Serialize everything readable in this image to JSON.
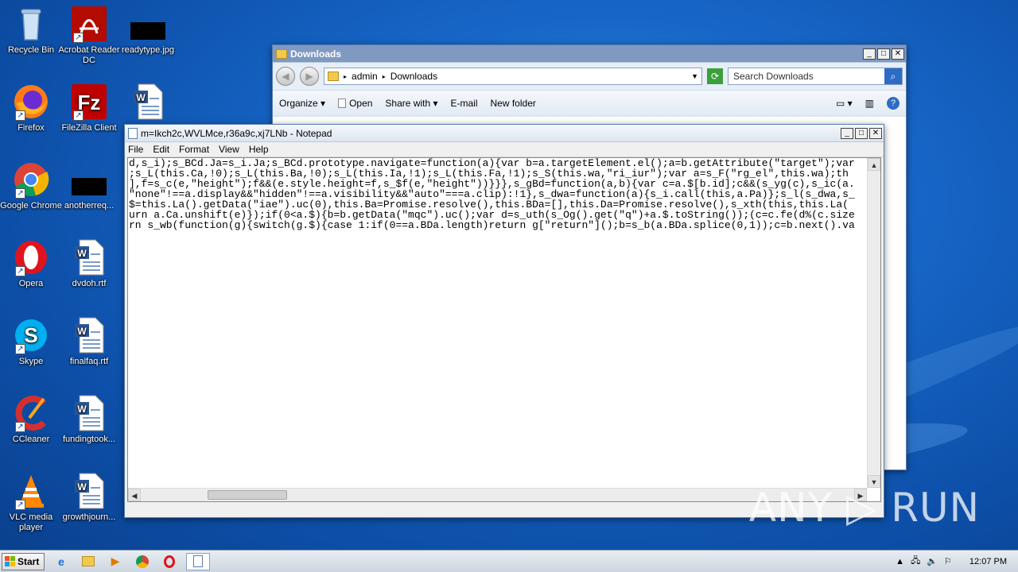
{
  "desktop": {
    "icons": [
      {
        "label": "Recycle Bin"
      },
      {
        "label": "Acrobat Reader DC"
      },
      {
        "label": "readytype.jpg"
      },
      {
        "label": "Firefox"
      },
      {
        "label": "FileZilla Client"
      },
      {
        "label": "Google Chrome"
      },
      {
        "label": "anotherreq..."
      },
      {
        "label": "Opera"
      },
      {
        "label": "dvdoh.rtf"
      },
      {
        "label": "Skype"
      },
      {
        "label": "finalfaq.rtf"
      },
      {
        "label": "CCleaner"
      },
      {
        "label": "fundingtook..."
      },
      {
        "label": "VLC media player"
      },
      {
        "label": "growthjourn..."
      }
    ],
    "watermark": "ANY ▷ RUN"
  },
  "explorer": {
    "title": "Downloads",
    "breadcrumb": [
      "admin",
      "Downloads"
    ],
    "search_placeholder": "Search Downloads",
    "toolbar": {
      "organize": "Organize",
      "open": "Open",
      "share_with": "Share with",
      "email": "E-mail",
      "new_folder": "New folder"
    }
  },
  "notepad": {
    "title": "m=Ikch2c,WVLMce,r36a9c,xj7LNb - Notepad",
    "menu": [
      "File",
      "Edit",
      "Format",
      "View",
      "Help"
    ],
    "lines": [
      "d,s_i);s_BCd.Ja=s_i.Ja;s_BCd.prototype.navigate=function(a){var b=a.targetElement.el();a=b.getAttribute(\"target\");var",
      ";s_L(this.Ca,!0);s_L(this.Ba,!0);s_L(this.Ia,!1);s_L(this.Fa,!1);s_S(this.wa,\"ri_iur\");var a=s_F(\"rg_el\",this.wa);th",
      "],f=s_c(e,\"height\");f&&(e.style.height=f,s_$f(e,\"height\"))}}},s_gBd=function(a,b){var c=a.$[b.id];c&&(s_yg(c),s_ic(a.",
      "\"none\"!==a.display&&\"hidden\"!==a.visibility&&\"auto\"===a.clip):!1},s_dwa=function(a){s_i.call(this,a.Pa)};s_l(s_dwa,s_",
      "$=this.La().getData(\"iae\").uc(0),this.Ba=Promise.resolve(),this.BDa=[],this.Da=Promise.resolve(),s_xth(this,this.La(",
      "urn a.Ca.unshift(e)});if(0<a.$){b=b.getData(\"mqc\").uc();var d=s_uth(s_Og().get(\"q\")+a.$.toString());(c=c.fe(d%(c.size",
      "rn s_wb(function(g){switch(g.$){case 1:if(0==a.BDa.length)return g[\"return\"]();b=s_b(a.BDa.splice(0,1));c=b.next().va"
    ]
  },
  "taskbar": {
    "start_label": "Start",
    "clock": "12:07 PM"
  }
}
